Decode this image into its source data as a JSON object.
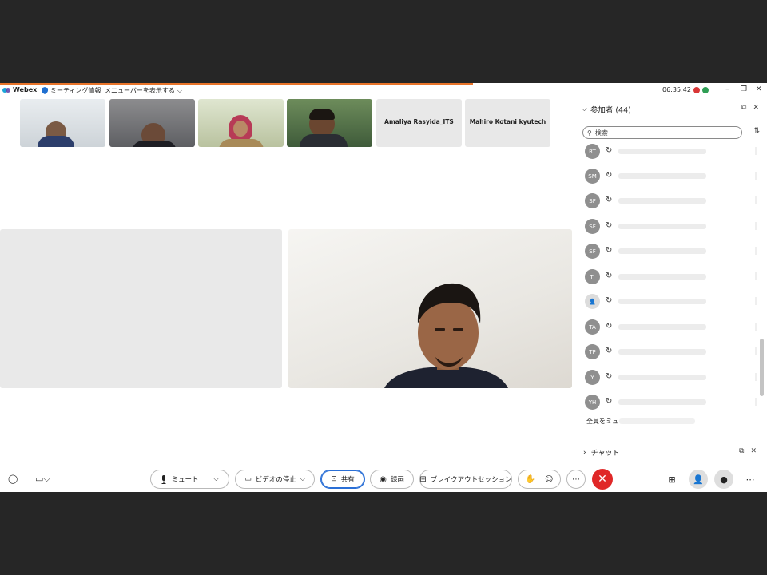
{
  "titlebar": {
    "app_name": "Webex",
    "meeting_info": "ミーティング情報",
    "show_menu": "メニューバーを表示する",
    "clock": "06:35:42"
  },
  "thumbnails": [
    {
      "name": ""
    },
    {
      "name": ""
    },
    {
      "name": ""
    },
    {
      "name": ""
    },
    {
      "name": "Amaliya Rasyida_ITS"
    },
    {
      "name": "Mahiro Kotani kyutech"
    }
  ],
  "panel": {
    "title": "参加者 (44)",
    "search_placeholder": "検索",
    "participants": [
      {
        "initials": "RT"
      },
      {
        "initials": "SM"
      },
      {
        "initials": "SF"
      },
      {
        "initials": "SF"
      },
      {
        "initials": "SF"
      },
      {
        "initials": "TI"
      },
      {
        "initials": ""
      },
      {
        "initials": "TA"
      },
      {
        "initials": "TP"
      },
      {
        "initials": "Y"
      },
      {
        "initials": "YH"
      }
    ],
    "mute_all": "全員をミュ",
    "chat_label": "チャット"
  },
  "toolbar": {
    "mute": "ミュート",
    "stop_video": "ビデオの停止",
    "share": "共有",
    "record": "録画",
    "breakout": "ブレイクアウトセッション"
  },
  "colors": {
    "accent_blue": "#2a6fd6",
    "end_red": "#e02828",
    "top_orange": "#e8742a"
  }
}
